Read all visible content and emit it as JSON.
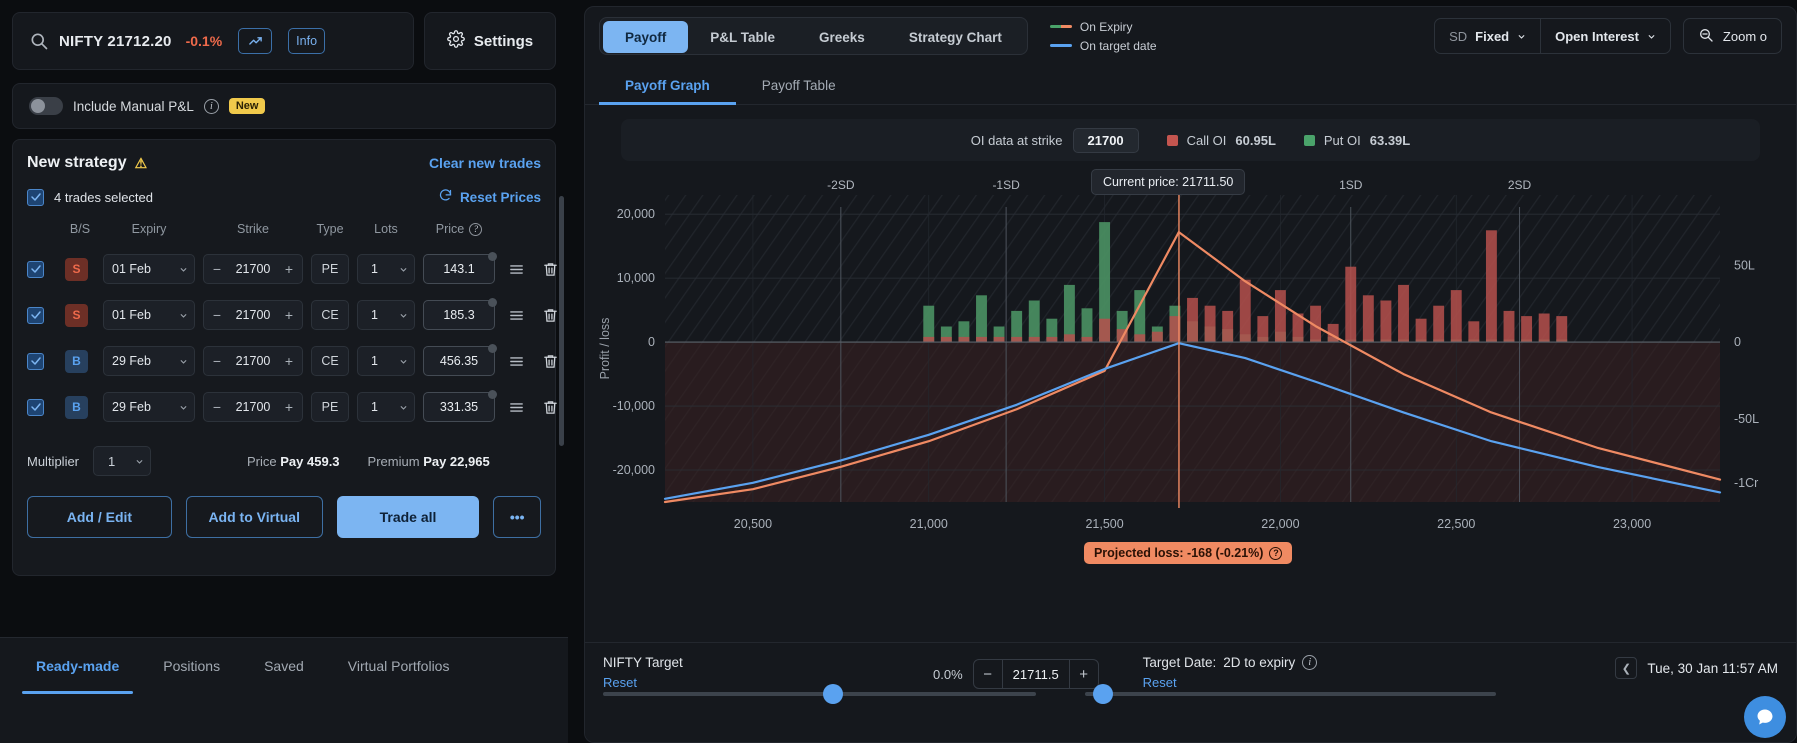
{
  "left": {
    "search": {
      "symbol": "NIFTY 21712.20",
      "change": "-0.1%",
      "chart_btn": "chart-icon",
      "info_btn": "Info"
    },
    "settings_label": "Settings",
    "manual": {
      "label": "Include Manual P&L",
      "badge": "New"
    },
    "strategy": {
      "title": "New strategy",
      "clear_label": "Clear new trades",
      "selected_label": "4 trades selected",
      "reset_prices_label": "Reset Prices",
      "columns": [
        "B/S",
        "Expiry",
        "Strike",
        "Type",
        "Lots",
        "Price"
      ],
      "rows": [
        {
          "bs": "S",
          "expiry": "01 Feb",
          "strike": "21700",
          "type": "PE",
          "lots": "1",
          "price": "143.1"
        },
        {
          "bs": "S",
          "expiry": "01 Feb",
          "strike": "21700",
          "type": "CE",
          "lots": "1",
          "price": "185.3"
        },
        {
          "bs": "B",
          "expiry": "29 Feb",
          "strike": "21700",
          "type": "CE",
          "lots": "1",
          "price": "456.35"
        },
        {
          "bs": "B",
          "expiry": "29 Feb",
          "strike": "21700",
          "type": "PE",
          "lots": "1",
          "price": "331.35"
        }
      ],
      "multiplier_label": "Multiplier",
      "multiplier_value": "1",
      "price_label": "Price",
      "price_value": "Pay 459.3",
      "premium_label": "Premium",
      "premium_value": "Pay 22,965",
      "buttons": {
        "add_edit": "Add / Edit",
        "add_virtual": "Add to Virtual",
        "trade_all": "Trade all",
        "more": "•••"
      }
    },
    "bottom_tabs": [
      {
        "label": "Ready-made",
        "active": true
      },
      {
        "label": "Positions",
        "active": false
      },
      {
        "label": "Saved",
        "active": false
      },
      {
        "label": "Virtual Portfolios",
        "active": false
      }
    ]
  },
  "right": {
    "main_tabs": [
      {
        "label": "Payoff",
        "active": true
      },
      {
        "label": "P&L Table",
        "active": false
      },
      {
        "label": "Greeks",
        "active": false
      },
      {
        "label": "Strategy Chart",
        "active": false
      }
    ],
    "legend": [
      {
        "label": "On Expiry",
        "color": "#ef8a63"
      },
      {
        "label": "On target date",
        "color": "#5aa2f0"
      }
    ],
    "controls": {
      "sd_prefix": "SD",
      "sd_value": "Fixed",
      "oi_mode": "Open Interest",
      "zoom_label": "Zoom o"
    },
    "sub_tabs": [
      {
        "label": "Payoff Graph",
        "active": true
      },
      {
        "label": "Payoff Table",
        "active": false
      }
    ],
    "oi_bar": {
      "strike_label": "OI data at strike",
      "strike_value": "21700",
      "call_label": "Call OI",
      "call_value": "60.95L",
      "call_color": "#c4554f",
      "put_label": "Put OI",
      "put_value": "63.39L",
      "put_color": "#4aa36a"
    },
    "chart_tooltips": {
      "current_price": "Current price: 21711.50",
      "projected_loss": "Projected loss: -168 (-0.21%)"
    },
    "bottom": {
      "nifty_target_label": "NIFTY Target",
      "nifty_reset": "Reset",
      "pct": "0.0%",
      "target_value": "21711.5",
      "target_date_label": "Target Date:",
      "target_date_value": "2D to expiry",
      "target_date_reset": "Reset",
      "date_display": "Tue, 30 Jan 11:57 AM"
    }
  },
  "chart_data": {
    "type": "line",
    "title": "Payoff Graph",
    "xlabel": "",
    "ylabel": "Profit / loss",
    "xlim": [
      20250,
      23250
    ],
    "ylim": [
      -25000,
      23000
    ],
    "xticks": [
      20500,
      21000,
      21500,
      22000,
      22500,
      23000
    ],
    "xticklabels": [
      "20,500",
      "21,000",
      "21,500",
      "22,000",
      "22,500",
      "23,000"
    ],
    "yticks": [
      20000,
      10000,
      0,
      -10000,
      -20000
    ],
    "yticklabels": [
      "20,000",
      "10,000",
      "0",
      "-10,000",
      "-20,000"
    ],
    "right_axis": {
      "label": "Open Interest",
      "ticks": [
        "50L",
        "0",
        "-50L",
        "-1Cr"
      ]
    },
    "sd_markers": [
      {
        "label": "-2SD",
        "x": 20750
      },
      {
        "label": "-1SD",
        "x": 21220
      },
      {
        "label": "1SD",
        "x": 22200
      },
      {
        "label": "2SD",
        "x": 22680
      }
    ],
    "current_price_line": 21711.5,
    "series": [
      {
        "name": "On Expiry",
        "color": "#ef8a63",
        "x": [
          20250,
          20500,
          20750,
          21000,
          21250,
          21500,
          21711,
          21900,
          22100,
          22350,
          22600,
          22900,
          23250
        ],
        "y": [
          -25500,
          -23000,
          -19500,
          -15500,
          -10500,
          -4500,
          17200,
          9500,
          2500,
          -5000,
          -11000,
          -16500,
          -21500
        ]
      },
      {
        "name": "On target date",
        "color": "#5aa2f0",
        "x": [
          20250,
          20500,
          20750,
          21000,
          21250,
          21500,
          21711,
          21900,
          22100,
          22350,
          22600,
          22900,
          23250
        ],
        "y": [
          -24500,
          -22000,
          -18500,
          -14500,
          -9800,
          -4200,
          -168,
          -2500,
          -6200,
          -11000,
          -15500,
          -19500,
          -23500
        ]
      }
    ],
    "oi_bars": {
      "call_color": "#c4554f",
      "put_color": "#4aa36a",
      "strikes": [
        21000,
        21050,
        21100,
        21150,
        21200,
        21250,
        21300,
        21350,
        21400,
        21450,
        21500,
        21550,
        21600,
        21650,
        21700,
        21750,
        21800,
        21850,
        21900,
        21950,
        22000,
        22050,
        22100,
        22150,
        22200,
        22250,
        22300,
        22350,
        22400,
        22450,
        22500,
        22550,
        22600,
        22650,
        22700,
        22750,
        22800
      ],
      "put_oi": [
        14,
        6,
        8,
        18,
        6,
        12,
        16,
        9,
        22,
        13,
        55,
        12,
        20,
        6,
        14,
        8,
        6,
        5,
        3,
        2,
        4,
        2,
        1,
        2,
        1,
        1,
        1,
        1,
        1,
        1,
        1,
        1,
        1,
        1,
        1,
        1,
        1
      ],
      "call_oi": [
        2,
        2,
        2,
        2,
        2,
        2,
        2,
        2,
        3,
        2,
        9,
        5,
        3,
        4,
        10,
        17,
        14,
        12,
        24,
        10,
        20,
        11,
        14,
        7,
        29,
        18,
        16,
        22,
        9,
        14,
        20,
        8,
        43,
        12,
        10,
        11,
        10
      ]
    }
  }
}
